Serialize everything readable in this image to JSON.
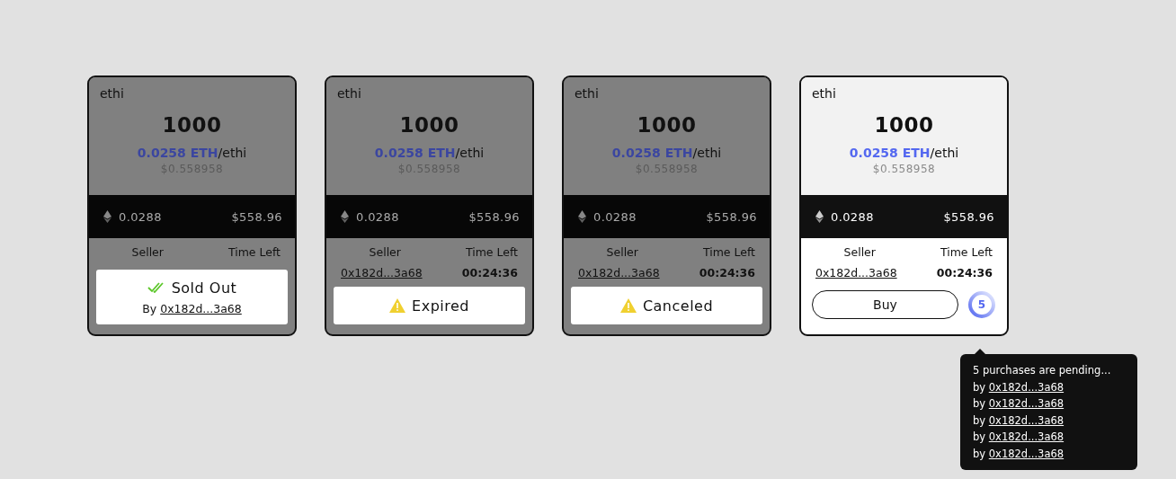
{
  "cards": [
    {
      "token": "ethi",
      "amount": "1000",
      "price_eth": "0.0258 ETH",
      "price_unit": "/ethi",
      "price_usd": "$0.558958",
      "total_eth": "0.0288",
      "total_usd": "$558.96",
      "seller_label": "Seller",
      "time_label": "Time Left",
      "status": {
        "kind": "sold_out",
        "title": "Sold Out",
        "by_label": "By",
        "buyer": "0x182d...3a68"
      }
    },
    {
      "token": "ethi",
      "amount": "1000",
      "price_eth": "0.0258 ETH",
      "price_unit": "/ethi",
      "price_usd": "$0.558958",
      "total_eth": "0.0288",
      "total_usd": "$558.96",
      "seller_label": "Seller",
      "time_label": "Time Left",
      "seller": "0x182d...3a68",
      "time_left": "00:24:36",
      "status": {
        "kind": "expired",
        "title": "Expired"
      }
    },
    {
      "token": "ethi",
      "amount": "1000",
      "price_eth": "0.0258 ETH",
      "price_unit": "/ethi",
      "price_usd": "$0.558958",
      "total_eth": "0.0288",
      "total_usd": "$558.96",
      "seller_label": "Seller",
      "time_label": "Time Left",
      "seller": "0x182d...3a68",
      "time_left": "00:24:36",
      "status": {
        "kind": "canceled",
        "title": "Canceled"
      }
    },
    {
      "token": "ethi",
      "amount": "1000",
      "price_eth": "0.0258 ETH",
      "price_unit": "/ethi",
      "price_usd": "$0.558958",
      "total_eth": "0.0288",
      "total_usd": "$558.96",
      "seller_label": "Seller",
      "time_label": "Time Left",
      "seller": "0x182d...3a68",
      "time_left": "00:24:36",
      "buy_label": "Buy",
      "pending_count": "5",
      "pending": {
        "title": "5 purchases are pending...",
        "buyers": [
          {
            "by": "by",
            "address": "0x182d...3a68"
          },
          {
            "by": "by",
            "address": "0x182d...3a68"
          },
          {
            "by": "by",
            "address": "0x182d...3a68"
          },
          {
            "by": "by",
            "address": "0x182d...3a68"
          },
          {
            "by": "by",
            "address": "0x182d...3a68"
          }
        ]
      }
    }
  ]
}
